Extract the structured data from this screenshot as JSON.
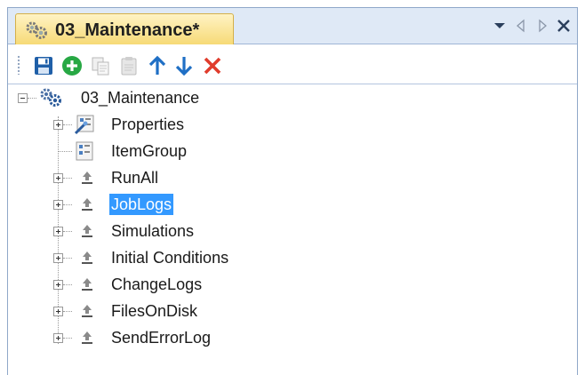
{
  "panel": {
    "tab_title": "03_Maintenance*",
    "controls": [
      "dropdown-icon",
      "scroll-left-icon",
      "scroll-right-icon",
      "close-icon"
    ]
  },
  "toolbar": {
    "buttons": [
      "save-icon",
      "add-icon",
      "copy-icon",
      "paste-icon",
      "move-up-icon",
      "move-down-icon",
      "delete-icon"
    ]
  },
  "tree": {
    "root": "03_Maintenance",
    "items": [
      {
        "label": "Properties",
        "icon": "properties-icon",
        "expandable": true,
        "selected": false
      },
      {
        "label": "ItemGroup",
        "icon": "itemgroup-icon",
        "expandable": false,
        "selected": false
      },
      {
        "label": "RunAll",
        "icon": "job-icon",
        "expandable": true,
        "selected": false
      },
      {
        "label": "JobLogs",
        "icon": "job-icon",
        "expandable": true,
        "selected": true
      },
      {
        "label": "Simulations",
        "icon": "job-icon",
        "expandable": true,
        "selected": false
      },
      {
        "label": "Initial Conditions",
        "icon": "job-icon",
        "expandable": true,
        "selected": false
      },
      {
        "label": "ChangeLogs",
        "icon": "job-icon",
        "expandable": true,
        "selected": false
      },
      {
        "label": "FilesOnDisk",
        "icon": "job-icon",
        "expandable": true,
        "selected": false
      },
      {
        "label": "SendErrorLog",
        "icon": "job-icon",
        "expandable": true,
        "selected": false
      }
    ]
  },
  "colors": {
    "tab_bg": "#f6d974",
    "header_bg": "#dfe9f6",
    "selection": "#3399ff",
    "accent_blue": "#1f6fc5",
    "add_green": "#27a844",
    "delete_red": "#e03c2c"
  }
}
